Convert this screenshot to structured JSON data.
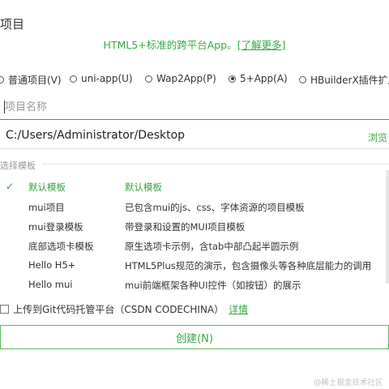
{
  "dialog": {
    "title": "项目",
    "subtitle": "HTML5+标准的跨平台App。",
    "subtitle_link": "[了解更多]"
  },
  "project_types": [
    {
      "label": "普通项目(V)",
      "checked": false
    },
    {
      "label": "uni-app(U)",
      "checked": false
    },
    {
      "label": "Wap2App(P)",
      "checked": false
    },
    {
      "label": "5+App(A)",
      "checked": true
    },
    {
      "label": "HBuilderX插件扩展",
      "checked": false
    }
  ],
  "name_field": {
    "value": "",
    "placeholder": "项目名称"
  },
  "location": {
    "path": "C:/Users/Administrator/Desktop",
    "browse_label": "浏览"
  },
  "templates": {
    "legend": "选择模板",
    "selected_icon": "checkmark-icon",
    "items": [
      {
        "name": "默认模板",
        "desc": "默认模板",
        "selected": true
      },
      {
        "name": "mui项目",
        "desc": "已包含mui的js、css、字体资源的项目模板",
        "selected": false
      },
      {
        "name": "mui登录模板",
        "desc": "带登录和设置的MUI项目模板",
        "selected": false
      },
      {
        "name": "底部选项卡模板",
        "desc": "原生选项卡示例，含tab中部凸起半圆示例",
        "selected": false
      },
      {
        "name": "Hello H5+",
        "desc": "HTML5Plus规范的演示，包含摄像头等各种底层能力的调用",
        "selected": false
      },
      {
        "name": "Hello mui",
        "desc": "mui前端框架各种UI控件（如按钮）的展示",
        "selected": false
      }
    ]
  },
  "git": {
    "label": "上传到Git代码托管平台（CSDN CODECHINA）",
    "details_link": "详情",
    "checked": false
  },
  "create_button": "创建(N)",
  "watermark": "@稀土掘金技术社区",
  "colors": {
    "accent": "#39a845",
    "border": "#5cb85c"
  }
}
